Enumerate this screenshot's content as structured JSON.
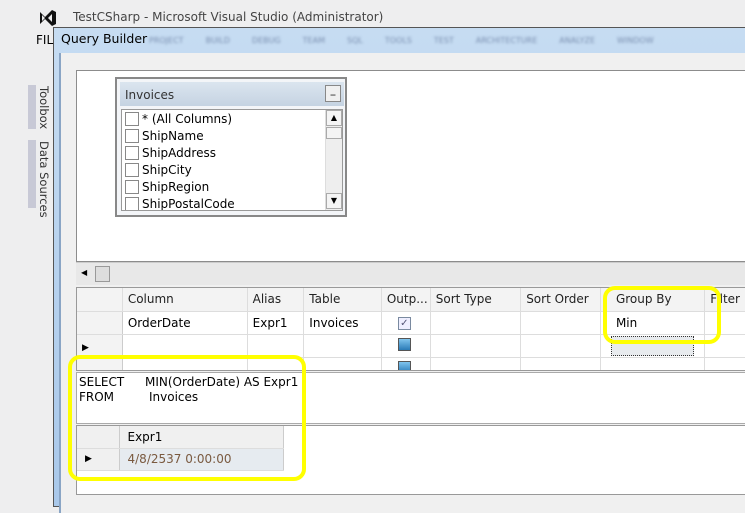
{
  "app": {
    "title": "TestCSharp - Microsoft Visual Studio (Administrator)",
    "menu_first": "FIL"
  },
  "side_tabs": [
    "Toolbox",
    "Data Sources"
  ],
  "dialog": {
    "title": "Query Builder",
    "blurred_menu": [
      "PROJECT",
      "BUILD",
      "DEBUG",
      "TEAM",
      "SQL",
      "TOOLS",
      "TEST",
      "ARCHITECTURE",
      "ANALYZE",
      "WINDOW"
    ]
  },
  "table_box": {
    "name": "Invoices",
    "columns": [
      "* (All Columns)",
      "ShipName",
      "ShipAddress",
      "ShipCity",
      "ShipRegion",
      "ShipPostalCode"
    ]
  },
  "grid": {
    "headers": [
      "Column",
      "Alias",
      "Table",
      "Outp...",
      "Sort Type",
      "Sort Order",
      "Group By",
      "Filter"
    ],
    "row": {
      "column": "OrderDate",
      "alias": "Expr1",
      "table": "Invoices",
      "group_by": "Min"
    }
  },
  "sql": {
    "line1_kw": "SELECT",
    "line1": "MIN(OrderDate) AS Expr1",
    "line2_kw": "FROM",
    "line2": "Invoices"
  },
  "results": {
    "header": "Expr1",
    "value": "4/8/2537 0:00:00"
  },
  "colors": {
    "highlight": "#ffff00",
    "title_bar": "#b7d2ee"
  }
}
